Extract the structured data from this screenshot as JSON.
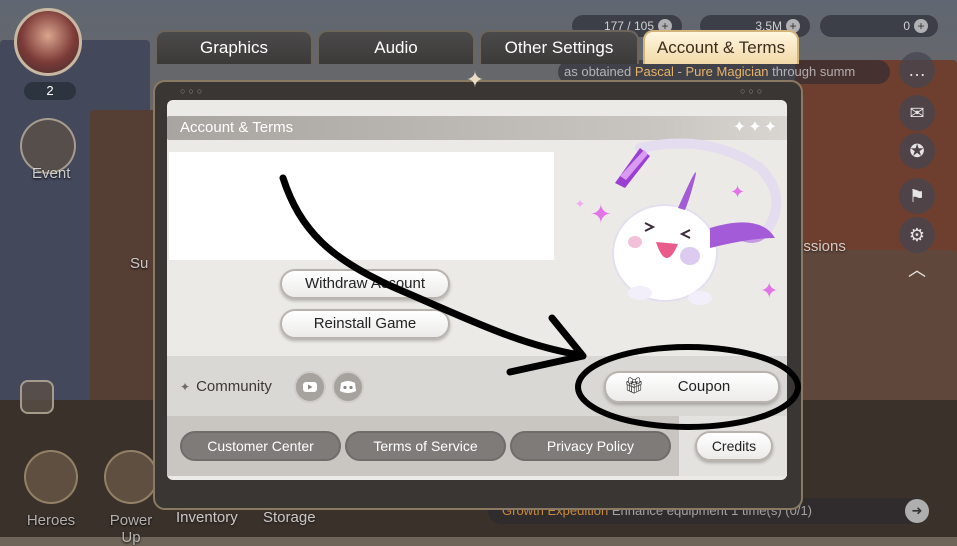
{
  "player": {
    "level": "2"
  },
  "left_menu": {
    "event_label": "Event",
    "su_label": "Su"
  },
  "resources": [
    {
      "text": "177 / 105"
    },
    {
      "text": "3.5M"
    },
    {
      "text": "0"
    }
  ],
  "ticker": {
    "prefix": "as obtained ",
    "name": "Pascal",
    "middle": " - ",
    "item": "Pure Magician",
    "suffix": " through summ"
  },
  "right_menu": {
    "missions_label": "issions"
  },
  "tabs": [
    {
      "label": "Graphics",
      "active": false
    },
    {
      "label": "Audio",
      "active": false
    },
    {
      "label": "Other Settings",
      "active": false
    },
    {
      "label": "Account & Terms",
      "active": true
    }
  ],
  "section": {
    "title": "Account & Terms"
  },
  "account_buttons": {
    "withdraw_label": "Withdraw Account",
    "reinstall_label": "Reinstall Game"
  },
  "community": {
    "label": "Community"
  },
  "coupon": {
    "label": "Coupon"
  },
  "footer": {
    "customer_center": "Customer Center",
    "terms_of_service": "Terms of Service",
    "privacy_policy": "Privacy Policy",
    "credits": "Credits"
  },
  "bottom_nav": [
    {
      "label": "Heroes"
    },
    {
      "label": "Power Up"
    },
    {
      "label": "Inventory"
    },
    {
      "label": "Storage"
    }
  ],
  "quest": {
    "highlight": "Growth Expedition",
    "text": " Enhance equipment 1 time(s) (0/1)"
  },
  "colors": {
    "accent_tab": "#f2d9a8",
    "annotation": "#000000"
  }
}
